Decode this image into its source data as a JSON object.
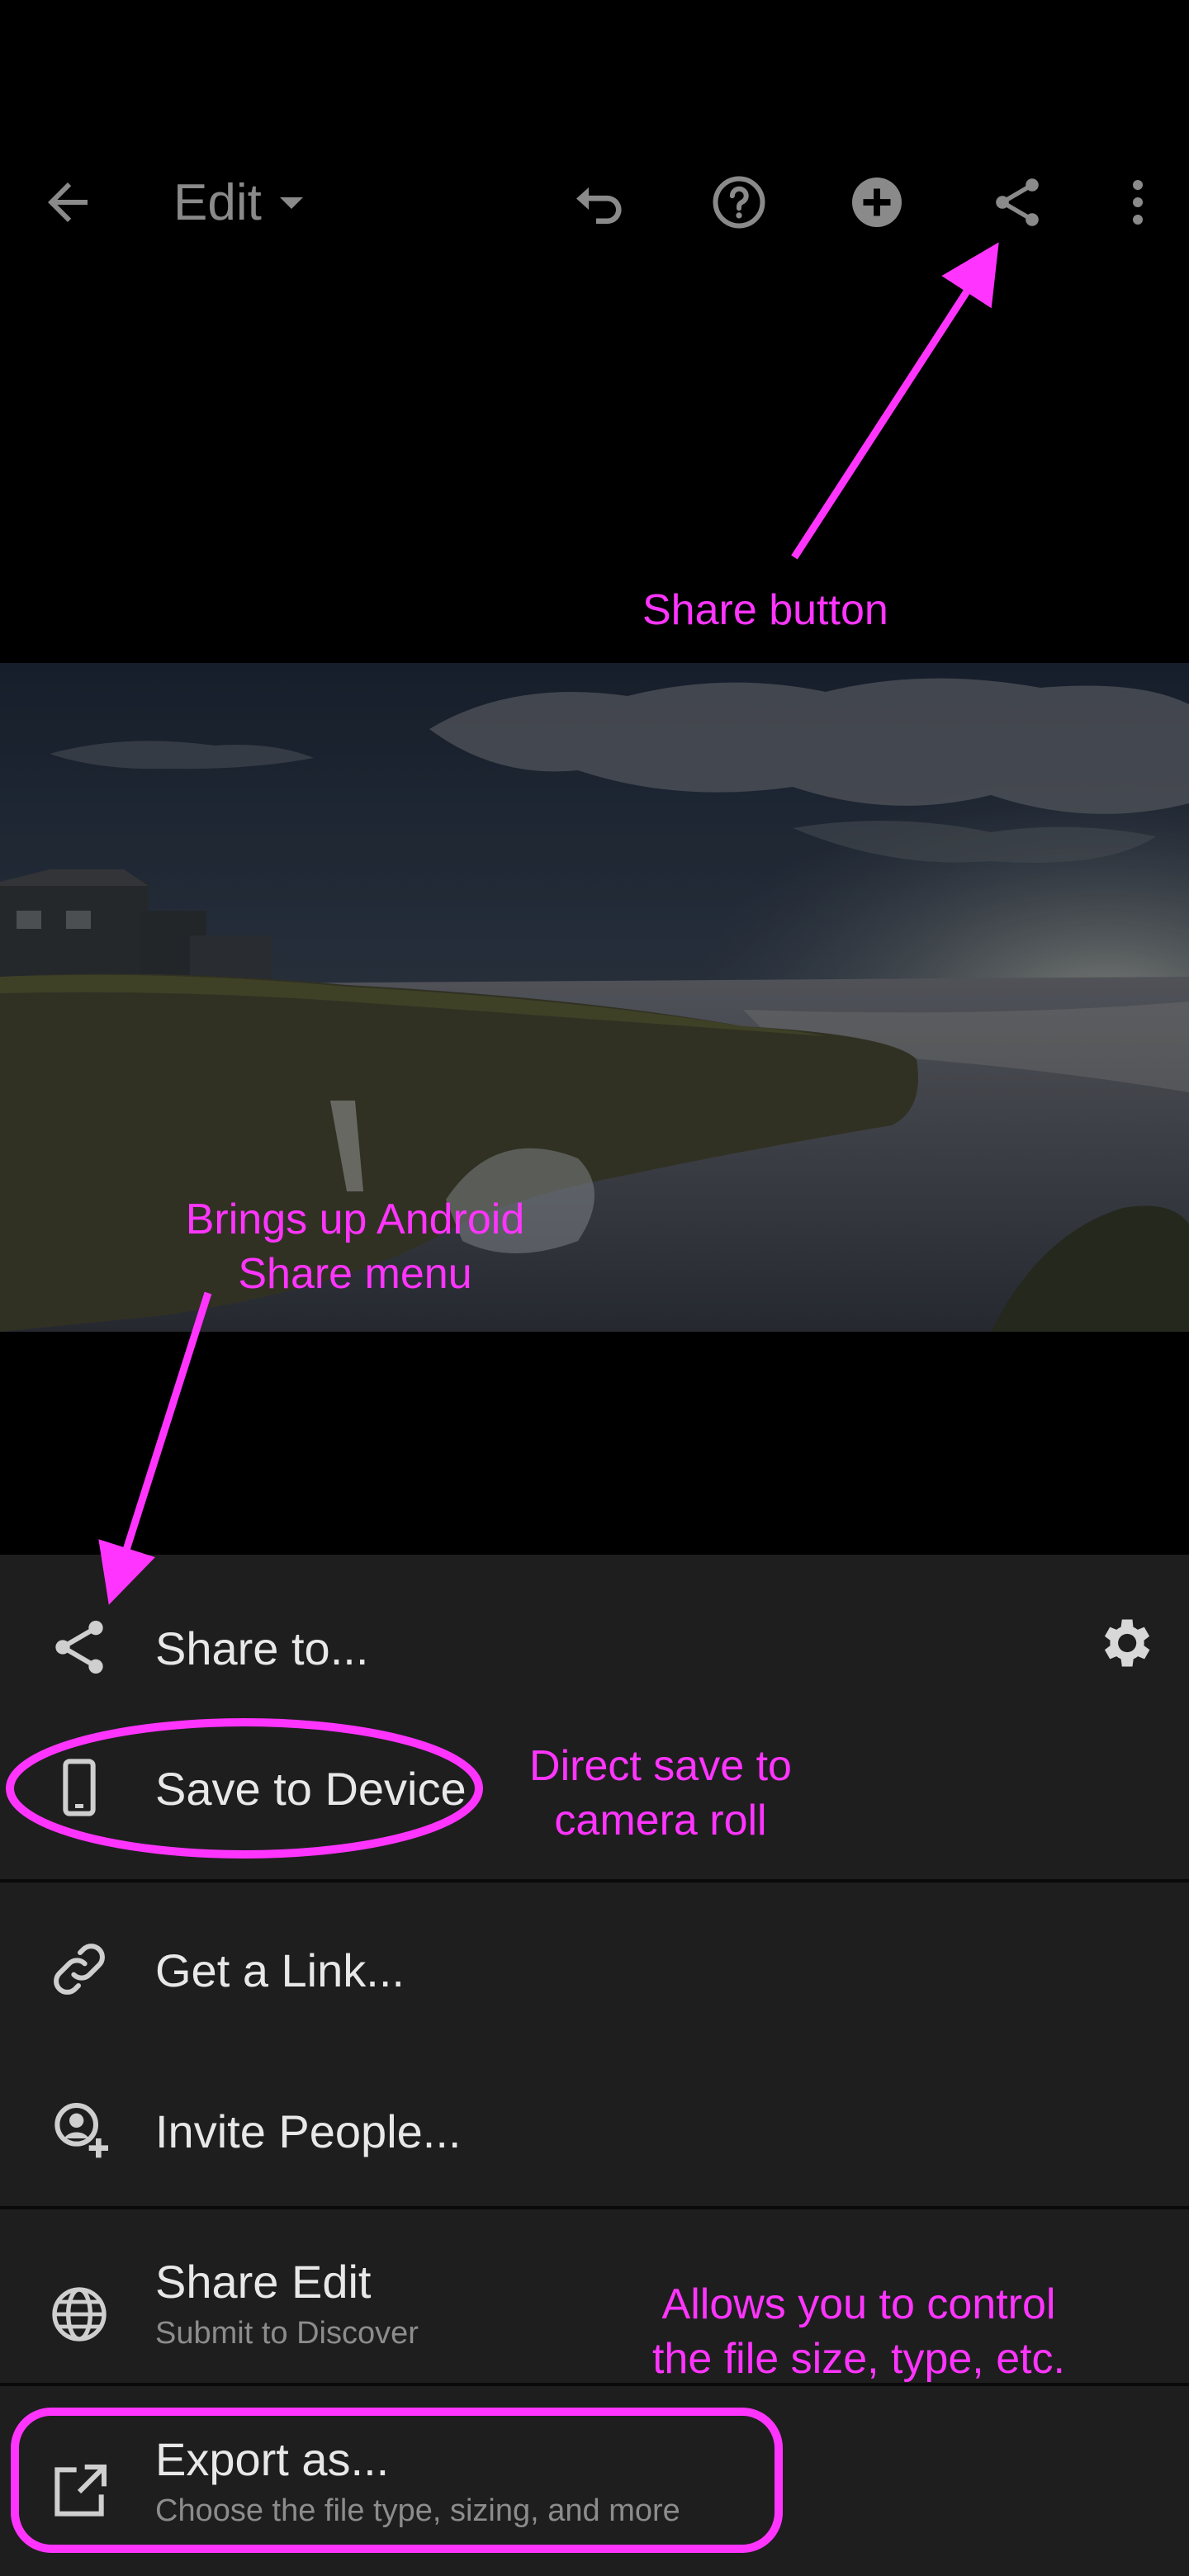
{
  "toolbar": {
    "back_icon": "back-arrow-icon",
    "edit_label": "Edit",
    "edit_dropdown_icon": "caret-down-icon",
    "undo_icon": "undo-icon",
    "help_icon": "help-icon",
    "add_icon": "add-circle-icon",
    "share_icon": "share-icon",
    "more_icon": "more-vertical-icon",
    "icon_color": "#8a8a8a"
  },
  "photo": {
    "subject": "coastal cliffs with houses and ocean at dusk",
    "icon": "photo-image"
  },
  "share_panel": {
    "background": "#1e1e1e",
    "share_to": {
      "label": "Share to...",
      "icon": "share-icon"
    },
    "settings_icon": "gear-icon",
    "save_to_device": {
      "label": "Save to Device",
      "icon": "phone-icon"
    },
    "get_link": {
      "label": "Get a Link...",
      "icon": "link-icon"
    },
    "invite_people": {
      "label": "Invite People...",
      "icon": "add-person-icon"
    },
    "share_edit": {
      "label": "Share Edit",
      "sublabel": "Submit to Discover",
      "icon": "globe-icon"
    },
    "export_as": {
      "label": "Export as...",
      "sublabel": "Choose the file type, sizing, and more",
      "icon": "export-icon"
    }
  },
  "annotations": {
    "color": "#ff35ff",
    "share_button": "Share button",
    "android_share_line1": "Brings up Android",
    "android_share_line2": "Share menu",
    "direct_save_line1": "Direct save to",
    "direct_save_line2": "camera roll",
    "export_line1": "Allows you to control",
    "export_line2": "the file size, type, etc."
  }
}
